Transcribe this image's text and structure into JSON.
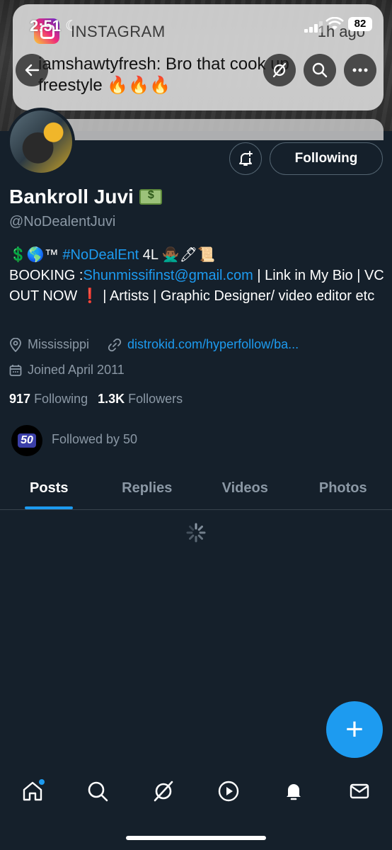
{
  "status_bar": {
    "time": "2:51",
    "battery": "82"
  },
  "notification": {
    "app": "INSTAGRAM",
    "time": "1h ago",
    "text": "iamshawtyfresh: Bro that cook up freestyle 🔥🔥🔥"
  },
  "profile": {
    "name": "Bankroll Juvi",
    "handle": "@NoDealentJuvi",
    "bio_prefix": "💲🌎™ ",
    "bio_hashtag": "#NoDealEnt",
    "bio_after_hashtag": " 4L 🙅🏾‍♂️🖊📜",
    "bio_booking": "BOOKING :",
    "bio_email": "Shunmissifinst@gmail.com",
    "bio_rest": " | Link in My Bio | VC OUT NOW ❗ | Artists | Graphic Designer/ video editor etc",
    "location": "Mississippi",
    "website": "distrokid.com/hyperfollow/ba...",
    "joined": "Joined April 2011",
    "following_count": "917",
    "following_label": "Following",
    "followers_count": "1.3K",
    "followers_label": "Followers",
    "followed_by": "Followed by 50",
    "followed_by_avatar_text": "50"
  },
  "buttons": {
    "following": "Following"
  },
  "tabs": [
    {
      "label": "Posts",
      "active": true
    },
    {
      "label": "Replies",
      "active": false
    },
    {
      "label": "Videos",
      "active": false
    },
    {
      "label": "Photos",
      "active": false
    }
  ],
  "fab_label": "+",
  "bottom_nav": [
    "home-icon",
    "search-icon",
    "grok-icon",
    "video-icon",
    "notifications-icon",
    "messages-icon"
  ],
  "colors": {
    "background": "#15202b",
    "accent": "#1d9bf0",
    "secondary_text": "#8b98a5"
  }
}
